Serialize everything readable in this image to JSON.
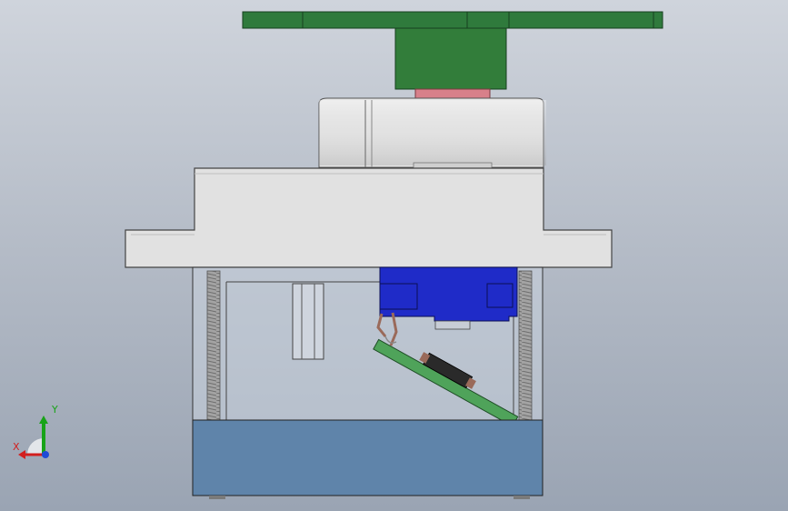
{
  "viewport": {
    "background_top": "#cfd4dc",
    "background_bottom": "#9aa4b3"
  },
  "model": {
    "horn_color": "#2f7a3c",
    "hub_color": "#327d3a",
    "bushing_color": "#d7808a",
    "top_cap_color": "#e6e6e6",
    "case_color": "#e1e1e1",
    "motor_color": "#1f2bc8",
    "pcb_color": "#4fa35a",
    "bottom_cover_color": "#5f84aa",
    "screw_color": "#9b9b9b"
  },
  "triad": {
    "x_label": "X",
    "y_label": "Y",
    "x_color": "#d21f1f",
    "y_color": "#18a318",
    "z_color": "#1f4bd6"
  }
}
